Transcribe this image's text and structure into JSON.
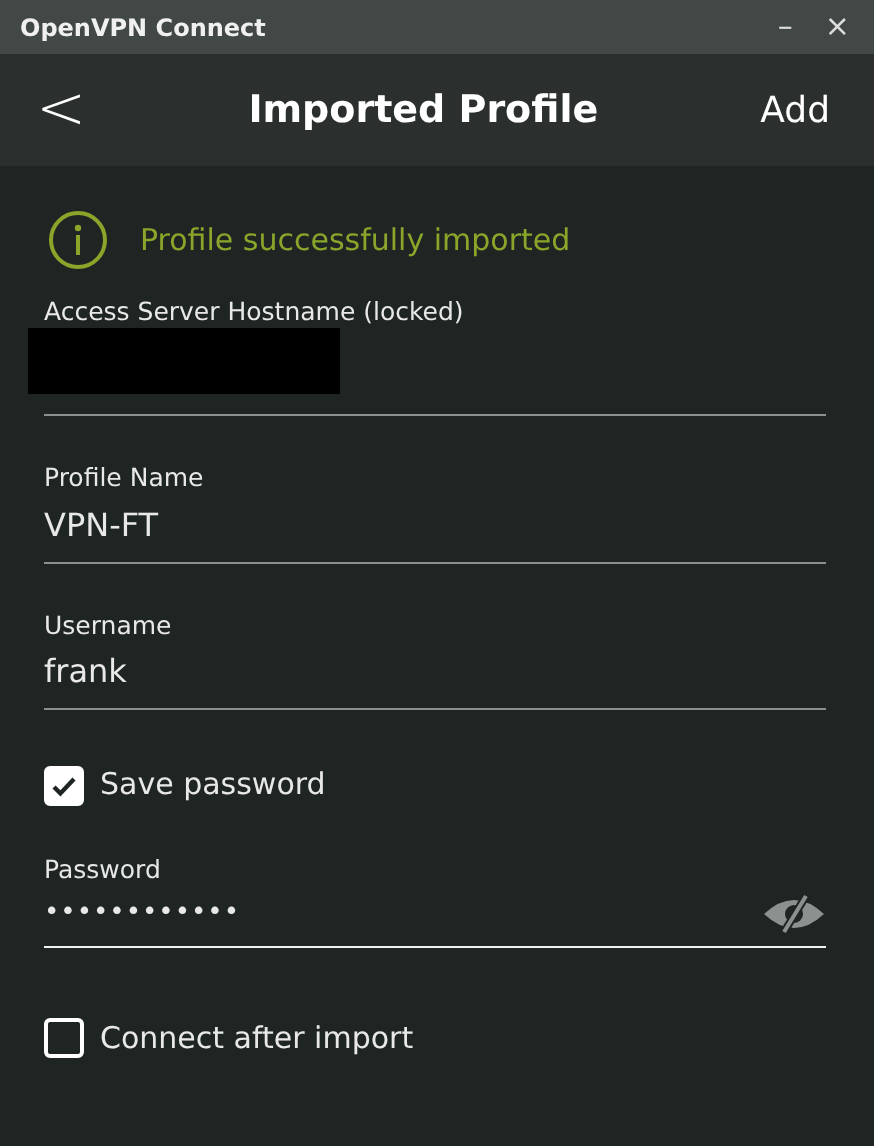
{
  "window": {
    "title": "OpenVPN Connect",
    "controls": [
      "–",
      "×"
    ]
  },
  "header": {
    "back": "<",
    "title": "Imported Profile",
    "action": "Add"
  },
  "notice": {
    "text": "Profile successfully imported"
  },
  "form": [
    {
      "kind": "redacted",
      "label": "Access Server Hostname (locked)"
    },
    {
      "kind": "text",
      "label": "Profile Name",
      "value": "VPN-FT"
    },
    {
      "kind": "text",
      "label": "Username",
      "value": "frank"
    },
    {
      "kind": "checkbox",
      "label": "Save password",
      "checked": true
    },
    {
      "kind": "password",
      "label": "Password",
      "value": "••••••••••••",
      "focused": true
    },
    {
      "kind": "checkbox",
      "label": "Connect after import",
      "checked": false
    }
  ]
}
